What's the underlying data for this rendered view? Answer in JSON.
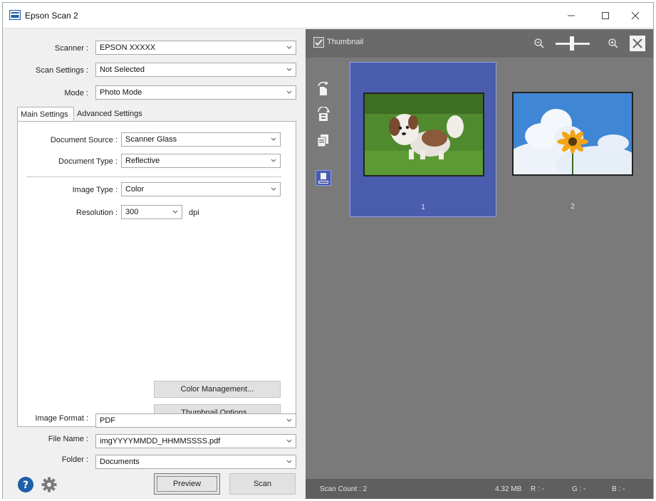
{
  "window": {
    "title": "Epson Scan 2"
  },
  "form": {
    "scanner": {
      "label": "Scanner :",
      "value": "EPSON XXXXX"
    },
    "scan_settings": {
      "label": "Scan Settings :",
      "value": "Not Selected"
    },
    "mode": {
      "label": "Mode :",
      "value": "Photo Mode"
    }
  },
  "tabs": [
    {
      "label": "Main Settings",
      "active": true
    },
    {
      "label": "Advanced Settings",
      "active": false
    }
  ],
  "main_settings": {
    "document_source": {
      "label": "Document Source :",
      "value": "Scanner Glass"
    },
    "document_type": {
      "label": "Document Type :",
      "value": "Reflective"
    },
    "image_type": {
      "label": "Image Type :",
      "value": "Color"
    },
    "resolution": {
      "label": "Resolution :",
      "value": "300",
      "unit": "dpi"
    },
    "color_management_label": "Color Management...",
    "thumbnail_options_label": "Thumbnail Options..."
  },
  "output": {
    "image_format": {
      "label": "Image Format :",
      "value": "PDF"
    },
    "file_name": {
      "label": "File Name :",
      "value": "imgYYYYMMDD_HHMMSSSS.pdf"
    },
    "folder": {
      "label": "Folder :",
      "value": "Documents"
    }
  },
  "footer": {
    "preview_label": "Preview",
    "scan_label": "Scan"
  },
  "preview": {
    "thumbnail_label": "Thumbnail",
    "thumbnail_checked": true,
    "items": [
      {
        "number": "1",
        "selected": true,
        "subject": "dog-on-grass"
      },
      {
        "number": "2",
        "selected": false,
        "subject": "sunflower-sky"
      }
    ],
    "side_tools": [
      "rotate-icon",
      "rotate-reverse-icon",
      "copy-icon",
      "auto-adjust-icon"
    ]
  },
  "status": {
    "scan_count": "Scan Count : 2",
    "size": "4.32 MB",
    "r": "R :  -",
    "g": "G :  -",
    "b": "B :  -"
  },
  "colors": {
    "accent": "#4a5cad",
    "panel_dark": "#7a7a7a",
    "toolbar": "#6a6a6a",
    "help_icon": "#1f5ea8"
  }
}
